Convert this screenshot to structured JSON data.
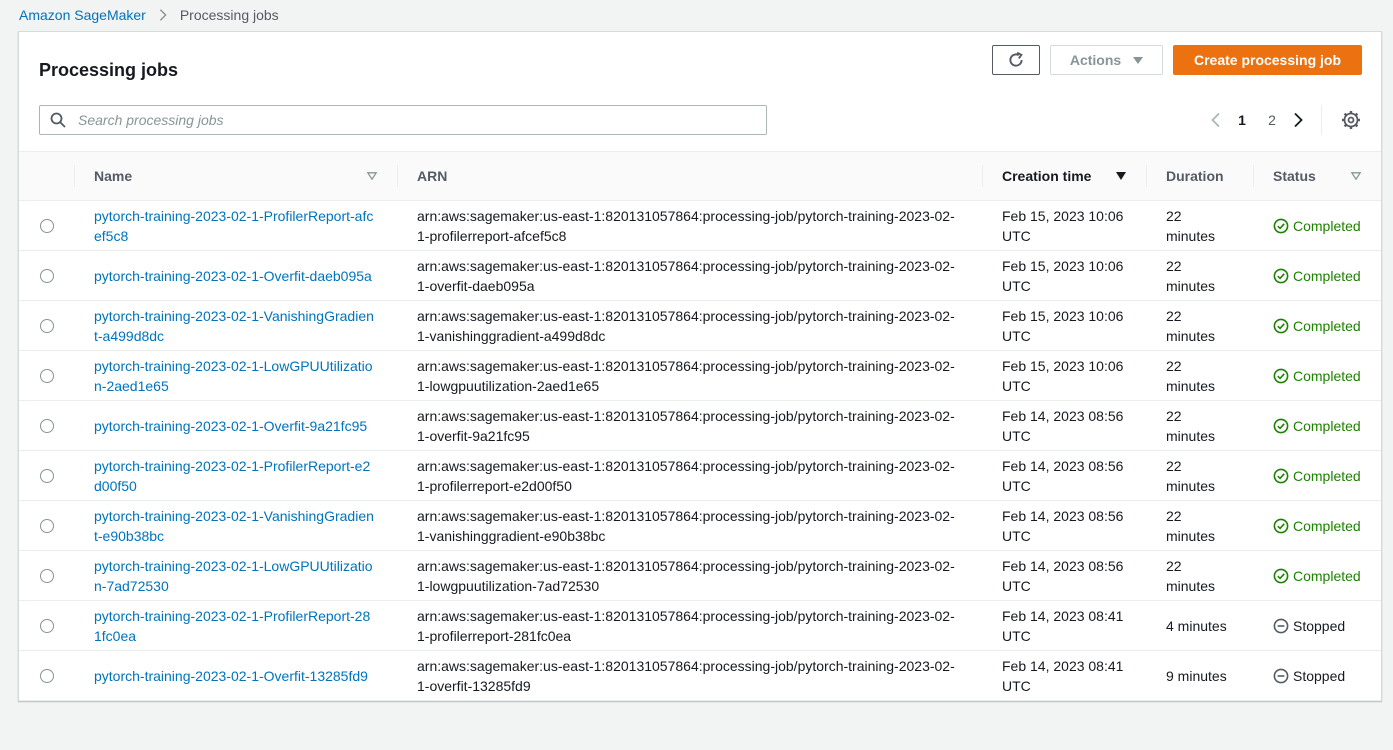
{
  "breadcrumb": {
    "root": "Amazon SageMaker",
    "current": "Processing jobs"
  },
  "panel": {
    "title": "Processing jobs",
    "actions_label": "Actions",
    "create_label": "Create processing job"
  },
  "search": {
    "placeholder": "Search processing jobs",
    "value": ""
  },
  "pagination": {
    "pages": [
      "1",
      "2"
    ],
    "current": "1"
  },
  "table": {
    "headers": {
      "name": "Name",
      "arn": "ARN",
      "creation_time": "Creation time",
      "duration": "Duration",
      "status": "Status"
    },
    "rows": [
      {
        "name": "pytorch-training-2023-02-1-ProfilerReport-afcef5c8",
        "arn": "arn:aws:sagemaker:us-east-1:820131057864:processing-job/pytorch-training-2023-02-1-profilerreport-afcef5c8",
        "created": "Feb 15, 2023 10:06 UTC",
        "duration": "22 minutes",
        "status": "Completed",
        "status_type": "completed"
      },
      {
        "name": "pytorch-training-2023-02-1-Overfit-daeb095a",
        "arn": "arn:aws:sagemaker:us-east-1:820131057864:processing-job/pytorch-training-2023-02-1-overfit-daeb095a",
        "created": "Feb 15, 2023 10:06 UTC",
        "duration": "22 minutes",
        "status": "Completed",
        "status_type": "completed"
      },
      {
        "name": "pytorch-training-2023-02-1-VanishingGradient-a499d8dc",
        "arn": "arn:aws:sagemaker:us-east-1:820131057864:processing-job/pytorch-training-2023-02-1-vanishinggradient-a499d8dc",
        "created": "Feb 15, 2023 10:06 UTC",
        "duration": "22 minutes",
        "status": "Completed",
        "status_type": "completed"
      },
      {
        "name": "pytorch-training-2023-02-1-LowGPUUtilization-2aed1e65",
        "arn": "arn:aws:sagemaker:us-east-1:820131057864:processing-job/pytorch-training-2023-02-1-lowgpuutilization-2aed1e65",
        "created": "Feb 15, 2023 10:06 UTC",
        "duration": "22 minutes",
        "status": "Completed",
        "status_type": "completed"
      },
      {
        "name": "pytorch-training-2023-02-1-Overfit-9a21fc95",
        "arn": "arn:aws:sagemaker:us-east-1:820131057864:processing-job/pytorch-training-2023-02-1-overfit-9a21fc95",
        "created": "Feb 14, 2023 08:56 UTC",
        "duration": "22 minutes",
        "status": "Completed",
        "status_type": "completed"
      },
      {
        "name": "pytorch-training-2023-02-1-ProfilerReport-e2d00f50",
        "arn": "arn:aws:sagemaker:us-east-1:820131057864:processing-job/pytorch-training-2023-02-1-profilerreport-e2d00f50",
        "created": "Feb 14, 2023 08:56 UTC",
        "duration": "22 minutes",
        "status": "Completed",
        "status_type": "completed"
      },
      {
        "name": "pytorch-training-2023-02-1-VanishingGradient-e90b38bc",
        "arn": "arn:aws:sagemaker:us-east-1:820131057864:processing-job/pytorch-training-2023-02-1-vanishinggradient-e90b38bc",
        "created": "Feb 14, 2023 08:56 UTC",
        "duration": "22 minutes",
        "status": "Completed",
        "status_type": "completed"
      },
      {
        "name": "pytorch-training-2023-02-1-LowGPUUtilization-7ad72530",
        "arn": "arn:aws:sagemaker:us-east-1:820131057864:processing-job/pytorch-training-2023-02-1-lowgpuutilization-7ad72530",
        "created": "Feb 14, 2023 08:56 UTC",
        "duration": "22 minutes",
        "status": "Completed",
        "status_type": "completed"
      },
      {
        "name": "pytorch-training-2023-02-1-ProfilerReport-281fc0ea",
        "arn": "arn:aws:sagemaker:us-east-1:820131057864:processing-job/pytorch-training-2023-02-1-profilerreport-281fc0ea",
        "created": "Feb 14, 2023 08:41 UTC",
        "duration": "4 minutes",
        "status": "Stopped",
        "status_type": "stopped"
      },
      {
        "name": "pytorch-training-2023-02-1-Overfit-13285fd9",
        "arn": "arn:aws:sagemaker:us-east-1:820131057864:processing-job/pytorch-training-2023-02-1-overfit-13285fd9",
        "created": "Feb 14, 2023 08:41 UTC",
        "duration": "9 minutes",
        "status": "Stopped",
        "status_type": "stopped"
      }
    ]
  },
  "colors": {
    "link": "#0073bb",
    "primary_button": "#ec7211",
    "status_completed": "#1d8102",
    "status_stopped": "#16191f"
  },
  "icons": {
    "refresh": "refresh-icon",
    "actions_caret": "caret-down-icon",
    "search": "search-icon",
    "prev_page": "chevron-left-icon",
    "next_page": "chevron-right-icon",
    "settings": "gear-icon",
    "completed": "check-circle-icon",
    "stopped": "stopped-circle-icon"
  }
}
